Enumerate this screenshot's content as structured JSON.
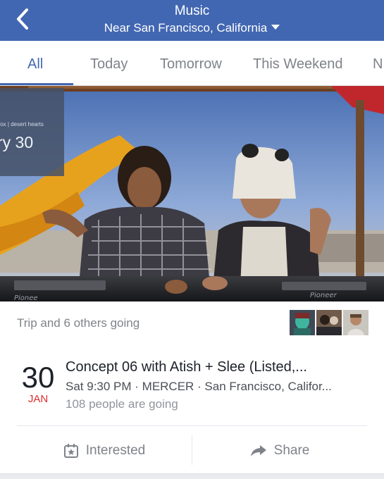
{
  "header": {
    "title": "Music",
    "location": "Near San Francisco, California"
  },
  "tabs": [
    {
      "label": "All",
      "active": true
    },
    {
      "label": "Today"
    },
    {
      "label": "Tomorrow"
    },
    {
      "label": "This Weekend"
    },
    {
      "label": "N"
    }
  ],
  "hero": {
    "card_small_text": "fox | desert hearts",
    "card_date_text": "ry 30"
  },
  "going": {
    "text": "Trip and 6 others going"
  },
  "event": {
    "day": "30",
    "month": "JAN",
    "title": "Concept 06 with Atish + Slee (Listed,...",
    "details": "Sat 9:30 PM · MERCER · San Francisco, Califor...",
    "attendance": "108 people are going"
  },
  "actions": {
    "interested": "Interested",
    "share": "Share"
  },
  "colors": {
    "header_bg": "#4267b2",
    "active_tab": "#4267b2",
    "month_red": "#db2d2d",
    "muted_text": "#7f8389"
  },
  "icons": {
    "back": "chevron-left-icon",
    "location_dropdown": "caret-down-icon",
    "interested": "calendar-star-icon",
    "share": "share-arrow-icon"
  }
}
